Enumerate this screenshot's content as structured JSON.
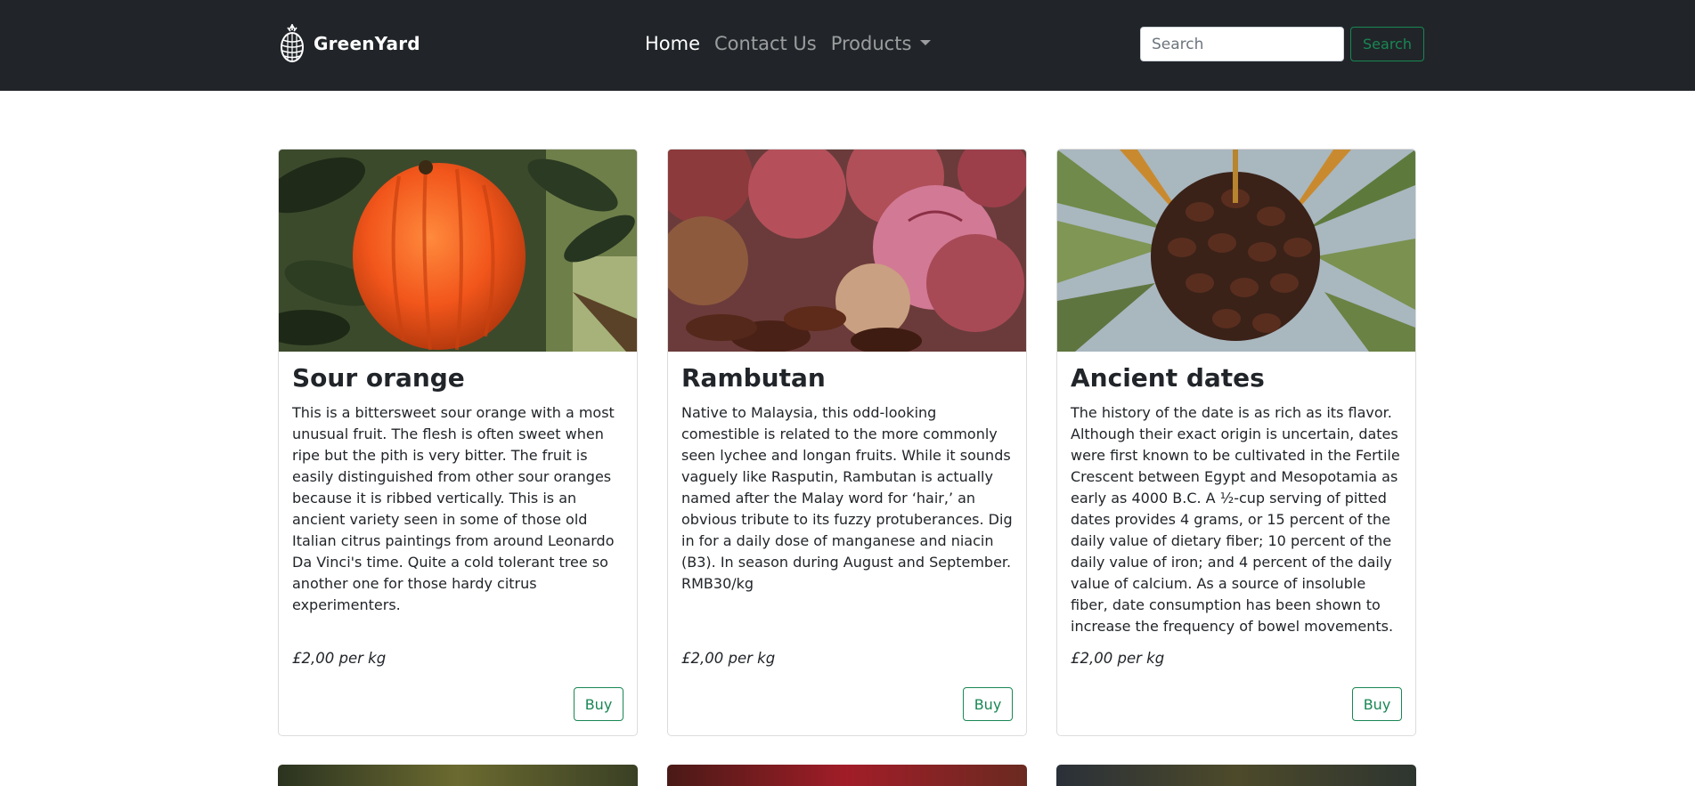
{
  "header": {
    "brand": "GreenYard",
    "nav": [
      {
        "label": "Home",
        "active": true
      },
      {
        "label": "Contact Us",
        "active": false
      },
      {
        "label": "Products",
        "active": false,
        "dropdown": true
      }
    ],
    "search": {
      "placeholder": "Search",
      "value": "",
      "button_label": "Search"
    }
  },
  "products": [
    {
      "title": "Sour orange",
      "description": "This is a bittersweet sour orange with a most unusual fruit. The flesh is often sweet when ripe but the pith is very bitter. The fruit is easily distinguished from other sour oranges because it is ribbed vertically. This is an ancient variety seen in some of those old Italian citrus paintings from around Leonardo Da Vinci's time. Quite a cold tolerant tree so another one for those hardy citrus experimenters.",
      "price": "£2,00 per kg",
      "buy_label": "Buy"
    },
    {
      "title": "Rambutan",
      "description": "Native to Malaysia, this odd-looking comestible is related to the more commonly seen lychee and longan fruits. While it sounds vaguely like Rasputin, Rambutan is actually named after the Malay word for ‘hair,’ an obvious tribute to its fuzzy protuberances. Dig in for a daily dose of manganese and niacin (B3). In season during August and September. RMB30/kg",
      "price": "£2,00 per kg",
      "buy_label": "Buy"
    },
    {
      "title": "Ancient dates",
      "description": "The history of the date is as rich as its flavor. Although their exact origin is uncertain, dates were first known to be cultivated in the Fertile Crescent between Egypt and Mesopotamia as early as 4000 B.C. A ½-cup serving of pitted dates provides 4 grams, or 15 percent of the daily value of dietary fiber; 10 percent of the daily value of iron; and 4 percent of the daily value of calcium. As a source of insoluble fiber, date consumption has been shown to increase the frequency of bowel movements.",
      "price": "£2,00 per kg",
      "buy_label": "Buy"
    }
  ],
  "colors": {
    "navbar_bg": "#212529",
    "accent_green": "#198754",
    "nav_inactive": "rgba(255,255,255,0.55)"
  },
  "icons": {
    "brand": "pineapple-logo-icon",
    "dropdown": "caret-down-icon"
  }
}
